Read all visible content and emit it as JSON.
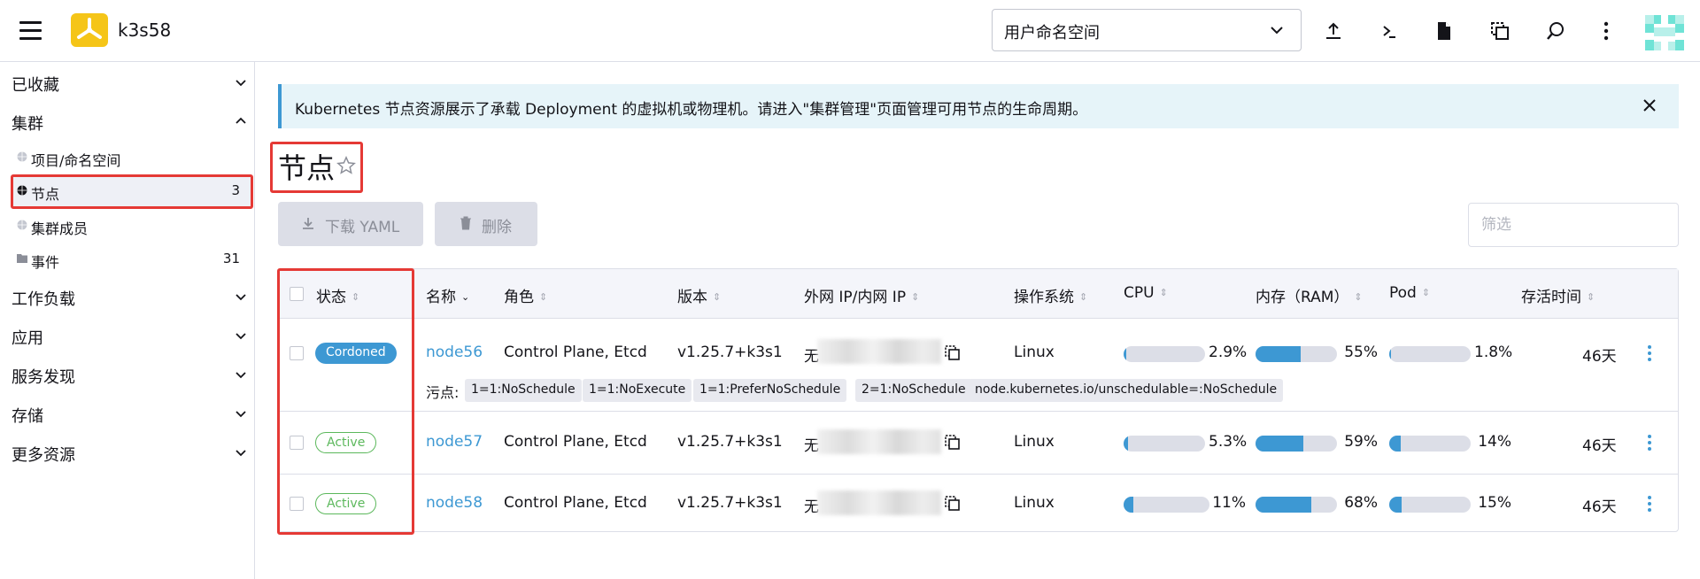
{
  "header": {
    "cluster_name": "k3s58",
    "namespace_select": "用户命名空间"
  },
  "sidebar": {
    "groups": {
      "favorites": "已收藏",
      "cluster": "集群",
      "workload": "工作负载",
      "apps": "应用",
      "service_discovery": "服务发现",
      "storage": "存储",
      "more_resources": "更多资源"
    },
    "items": [
      {
        "label": "项目/命名空间",
        "count": ""
      },
      {
        "label": "节点",
        "count": "3"
      },
      {
        "label": "集群成员",
        "count": ""
      },
      {
        "label": "事件",
        "count": "31"
      }
    ]
  },
  "banner": {
    "message": "Kubernetes 节点资源展示了承载 Deployment 的虚拟机或物理机。请进入\"集群管理\"页面管理可用节点的生命周期。"
  },
  "page": {
    "title": "节点",
    "download_yaml": "下载 YAML",
    "delete": "删除",
    "filter_placeholder": "筛选"
  },
  "table": {
    "columns": {
      "state": "状态",
      "name": "名称",
      "roles": "角色",
      "version": "版本",
      "ip": "外网 IP/内网 IP",
      "os": "操作系统",
      "cpu": "CPU",
      "ram": "内存（RAM）",
      "pod": "Pod",
      "age": "存活时间"
    },
    "taints_label": "污点:",
    "rows": [
      {
        "state": "Cordoned",
        "name": "node56",
        "roles": "Control Plane, Etcd",
        "version": "v1.25.7+k3s1",
        "ip_prefix": "无",
        "os": "Linux",
        "cpu": "2.9%",
        "cpu_value": 0.029,
        "ram": "55%",
        "ram_value": 0.55,
        "pod": "1.8%",
        "pod_value": 0.018,
        "age": "46天",
        "taints": [
          "1=1:NoSchedule",
          "1=1:NoExecute",
          "1=1:PreferNoSchedule",
          "2=1:NoSchedule",
          "node.kubernetes.io/unschedulable=:NoSchedule"
        ]
      },
      {
        "state": "Active",
        "name": "node57",
        "roles": "Control Plane, Etcd",
        "version": "v1.25.7+k3s1",
        "ip_prefix": "无",
        "os": "Linux",
        "cpu": "5.3%",
        "cpu_value": 0.053,
        "ram": "59%",
        "ram_value": 0.59,
        "pod": "14%",
        "pod_value": 0.14,
        "age": "46天"
      },
      {
        "state": "Active",
        "name": "node58",
        "roles": "Control Plane, Etcd",
        "version": "v1.25.7+k3s1",
        "ip_prefix": "无",
        "os": "Linux",
        "cpu": "11%",
        "cpu_value": 0.11,
        "ram": "68%",
        "ram_value": 0.68,
        "pod": "15%",
        "pod_value": 0.15,
        "age": "46天"
      }
    ]
  },
  "colors": {
    "accent": "#3d98d3",
    "active": "#5cb85c",
    "highlight": "#e53935",
    "logo": "#f5c518"
  }
}
